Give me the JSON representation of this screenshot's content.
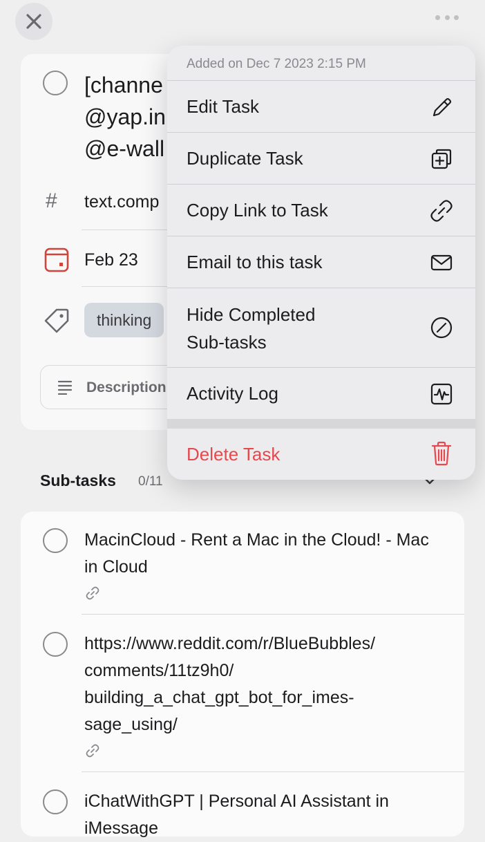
{
  "task": {
    "title_line1": "[channe",
    "title_line2": "@yap.in",
    "title_line3": "@e-wall",
    "project": "text.comp",
    "due_date": "Feb 23",
    "label": "thinking",
    "description_placeholder": "Description"
  },
  "subtasks": {
    "header": "Sub-tasks",
    "count": "0/11",
    "items": [
      {
        "text": "MacinCloud - Rent a Mac in the Cloud! - Mac in Cloud"
      },
      {
        "text": "https://www.reddit.com/r/BlueBubbles/ comments/11tz9h0/ building_a_chat_gpt_bot_for_imes- sage_using/"
      },
      {
        "text": "iChatWithGPT | Personal AI Assistant in iMessage"
      }
    ]
  },
  "menu": {
    "added_on": "Added on Dec 7 2023 2:15 PM",
    "items": [
      {
        "label": "Edit Task",
        "icon": "pencil-icon"
      },
      {
        "label": "Duplicate Task",
        "icon": "duplicate-icon"
      },
      {
        "label": "Copy Link to Task",
        "icon": "link-icon"
      },
      {
        "label": "Email to this task",
        "icon": "envelope-icon"
      },
      {
        "label": "Hide Completed Sub-tasks",
        "label_line1": "Hide Completed",
        "label_line2": "Sub-tasks",
        "icon": "slash-circle-icon"
      },
      {
        "label": "Activity Log",
        "icon": "activity-icon"
      }
    ],
    "delete": {
      "label": "Delete Task",
      "icon": "trash-icon"
    }
  },
  "colors": {
    "destructive": "#e5484d",
    "due_date_icon": "#d0453b",
    "label_pill": "#d4d9e0"
  }
}
